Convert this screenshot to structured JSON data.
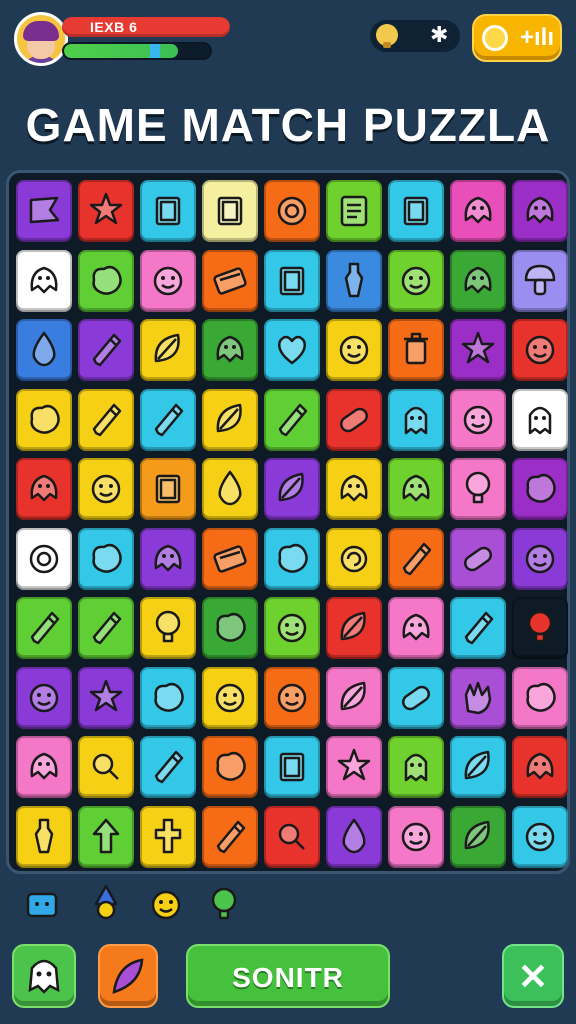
{
  "player": {
    "name": "IEXB 6",
    "progress": 0.78
  },
  "currency": {
    "coins_label": "+ılı"
  },
  "title": "GAME MATCH PUZZLA",
  "submit_label": "SONITR",
  "close_label": "✕",
  "board": {
    "cols": 9,
    "rows": 10,
    "tiles": [
      {
        "color": "#8a3ad6",
        "icon": "flag-icon"
      },
      {
        "color": "#e8332c",
        "icon": "star-icon"
      },
      {
        "color": "#33c7e8",
        "icon": "box-icon"
      },
      {
        "color": "#f5f0a0",
        "icon": "box-icon"
      },
      {
        "color": "#f56b16",
        "icon": "circle-icon"
      },
      {
        "color": "#6ed12e",
        "icon": "note-icon"
      },
      {
        "color": "#33c7e8",
        "icon": "box-icon"
      },
      {
        "color": "#e84fb8",
        "icon": "creature-icon"
      },
      {
        "color": "#9b2ec7",
        "icon": "creature-icon"
      },
      {
        "color": "#ffffff",
        "icon": "creature-icon"
      },
      {
        "color": "#5fcf35",
        "icon": "blob-icon"
      },
      {
        "color": "#f577c8",
        "icon": "face-icon"
      },
      {
        "color": "#f56b16",
        "icon": "keyboard-icon"
      },
      {
        "color": "#33c7e8",
        "icon": "box-icon"
      },
      {
        "color": "#3a8ae0",
        "icon": "bottle-icon"
      },
      {
        "color": "#6ed12e",
        "icon": "face-icon"
      },
      {
        "color": "#3aa835",
        "icon": "creature-icon"
      },
      {
        "color": "#9b8ef0",
        "icon": "mushroom-icon"
      },
      {
        "color": "#3a7de0",
        "icon": "drop-icon"
      },
      {
        "color": "#8a3ad6",
        "icon": "pencil-icon"
      },
      {
        "color": "#f5d015",
        "icon": "leaf-icon"
      },
      {
        "color": "#3aa835",
        "icon": "creature-icon"
      },
      {
        "color": "#33c7e8",
        "icon": "heart-icon"
      },
      {
        "color": "#f5d015",
        "icon": "face-icon"
      },
      {
        "color": "#f56b16",
        "icon": "bin-icon"
      },
      {
        "color": "#9b2ec7",
        "icon": "star-icon"
      },
      {
        "color": "#e8332c",
        "icon": "face-icon"
      },
      {
        "color": "#f5d015",
        "icon": "blob-icon"
      },
      {
        "color": "#f5d015",
        "icon": "pencil-icon"
      },
      {
        "color": "#33c7e8",
        "icon": "pencil-icon"
      },
      {
        "color": "#f5d015",
        "icon": "leaf-icon"
      },
      {
        "color": "#5fcf35",
        "icon": "pencil-icon"
      },
      {
        "color": "#e8332c",
        "icon": "pill-icon"
      },
      {
        "color": "#33c7e8",
        "icon": "ghost-icon"
      },
      {
        "color": "#f577c8",
        "icon": "face-icon"
      },
      {
        "color": "#ffffff",
        "icon": "ghost-icon"
      },
      {
        "color": "#e8332c",
        "icon": "creature-icon"
      },
      {
        "color": "#f5d015",
        "icon": "face-icon"
      },
      {
        "color": "#f59b1b",
        "icon": "box-icon"
      },
      {
        "color": "#f5d015",
        "icon": "drop-icon"
      },
      {
        "color": "#8a3ad6",
        "icon": "leaf-icon"
      },
      {
        "color": "#f5d015",
        "icon": "creature-icon"
      },
      {
        "color": "#6ed12e",
        "icon": "creature-icon"
      },
      {
        "color": "#f577c8",
        "icon": "bulb-icon"
      },
      {
        "color": "#9b2ec7",
        "icon": "blob-icon"
      },
      {
        "color": "#ffffff",
        "icon": "circle-icon"
      },
      {
        "color": "#33c7e8",
        "icon": "blob-icon"
      },
      {
        "color": "#8a3ad6",
        "icon": "creature-icon"
      },
      {
        "color": "#f56b16",
        "icon": "keyboard-icon"
      },
      {
        "color": "#33c7e8",
        "icon": "blob-icon"
      },
      {
        "color": "#f5d015",
        "icon": "refresh-icon"
      },
      {
        "color": "#f56b16",
        "icon": "pencil-icon"
      },
      {
        "color": "#a84fd6",
        "icon": "pill-icon"
      },
      {
        "color": "#8a3ad6",
        "icon": "face-icon"
      },
      {
        "color": "#5fcf35",
        "icon": "pencil-icon"
      },
      {
        "color": "#5fcf35",
        "icon": "pencil-icon"
      },
      {
        "color": "#f5d015",
        "icon": "bulb-icon"
      },
      {
        "color": "#3aa835",
        "icon": "blob-icon"
      },
      {
        "color": "#6ed12e",
        "icon": "face-icon"
      },
      {
        "color": "#e8332c",
        "icon": "leaf-icon"
      },
      {
        "color": "#f577c8",
        "icon": "creature-icon"
      },
      {
        "color": "#33c7e8",
        "icon": "pencil-icon"
      },
      {
        "color": "#0e1a26",
        "icon": "bulb-icon"
      },
      {
        "color": "#8a3ad6",
        "icon": "face-icon"
      },
      {
        "color": "#8a3ad6",
        "icon": "star-icon"
      },
      {
        "color": "#33c7e8",
        "icon": "blob-icon"
      },
      {
        "color": "#f5d015",
        "icon": "face-icon"
      },
      {
        "color": "#f56b16",
        "icon": "face-icon"
      },
      {
        "color": "#f577c8",
        "icon": "leaf-icon"
      },
      {
        "color": "#33c7e8",
        "icon": "pill-icon"
      },
      {
        "color": "#a84fd6",
        "icon": "hand-icon"
      },
      {
        "color": "#f577c8",
        "icon": "blob-icon"
      },
      {
        "color": "#f577c8",
        "icon": "creature-icon"
      },
      {
        "color": "#f5d015",
        "icon": "search-icon"
      },
      {
        "color": "#33c7e8",
        "icon": "pencil-icon"
      },
      {
        "color": "#f56b16",
        "icon": "blob-icon"
      },
      {
        "color": "#33c7e8",
        "icon": "box-icon"
      },
      {
        "color": "#f577c8",
        "icon": "star-icon"
      },
      {
        "color": "#6ed12e",
        "icon": "ghost-icon"
      },
      {
        "color": "#33c7e8",
        "icon": "leaf-icon"
      },
      {
        "color": "#e8332c",
        "icon": "creature-icon"
      },
      {
        "color": "#f5d015",
        "icon": "bottle-icon"
      },
      {
        "color": "#5fcf35",
        "icon": "arrow-icon"
      },
      {
        "color": "#f5d015",
        "icon": "cross-icon"
      },
      {
        "color": "#f56b16",
        "icon": "pencil-icon"
      },
      {
        "color": "#e8332c",
        "icon": "search-icon"
      },
      {
        "color": "#8a3ad6",
        "icon": "drop-icon"
      },
      {
        "color": "#f577c8",
        "icon": "face-icon"
      },
      {
        "color": "#3aa835",
        "icon": "leaf-icon"
      },
      {
        "color": "#33c7e8",
        "icon": "face-icon"
      }
    ]
  },
  "tray": [
    {
      "icon": "robot-icon",
      "color": "#33a8e8"
    },
    {
      "icon": "gnome-icon",
      "color": "#3a6ee0"
    },
    {
      "icon": "face-icon",
      "color": "#f5d015"
    },
    {
      "icon": "bulb-icon",
      "color": "#4cc34a"
    }
  ],
  "colors": {
    "background": "#1f3a52",
    "board": "#0e1a26",
    "accent": "#f7b500"
  }
}
